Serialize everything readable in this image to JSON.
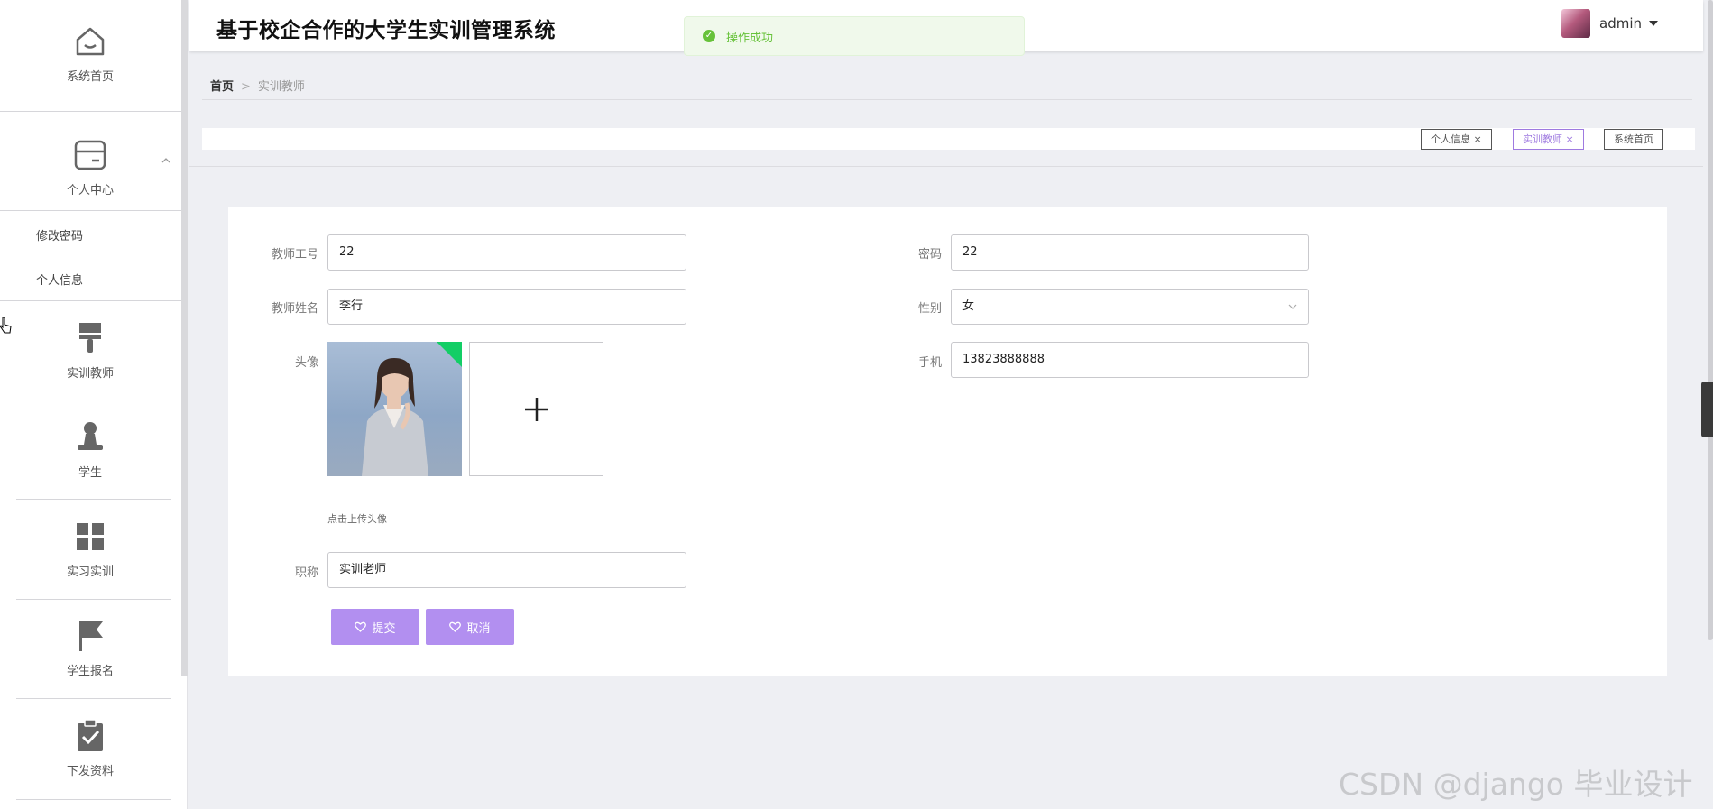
{
  "header": {
    "title": "基于校企合作的大学生实训管理系统",
    "user": "admin"
  },
  "toast": {
    "message": "操作成功"
  },
  "sidebar": {
    "home": "系统首页",
    "personal_center": "个人中心",
    "sub_items": [
      "修改密码",
      "个人信息"
    ],
    "items": [
      "实训教师",
      "学生",
      "实习实训",
      "学生报名",
      "下发资料"
    ]
  },
  "breadcrumb": {
    "home": "首页",
    "separator": ">",
    "current": "实训教师"
  },
  "tags": [
    {
      "label": "个人信息",
      "closable": true,
      "active": false
    },
    {
      "label": "实训教师",
      "closable": true,
      "active": true
    },
    {
      "label": "系统首页",
      "closable": false,
      "active": false
    }
  ],
  "form": {
    "teacher_no": {
      "label": "教师工号",
      "value": "22"
    },
    "password": {
      "label": "密码",
      "value": "22"
    },
    "teacher_name": {
      "label": "教师姓名",
      "value": "李行"
    },
    "gender": {
      "label": "性别",
      "value": "女"
    },
    "avatar": {
      "label": "头像",
      "hint": "点击上传头像"
    },
    "phone": {
      "label": "手机",
      "value": "13823888888"
    },
    "title": {
      "label": "职称",
      "value": "实训老师"
    },
    "submit": "提交",
    "cancel": "取消"
  },
  "watermark": "CSDN @django 毕业设计",
  "colors": {
    "accent": "#b28ff0",
    "tag_active": "#9f7ae0",
    "success": "#67c23a",
    "upload_corner": "#13ce66"
  }
}
